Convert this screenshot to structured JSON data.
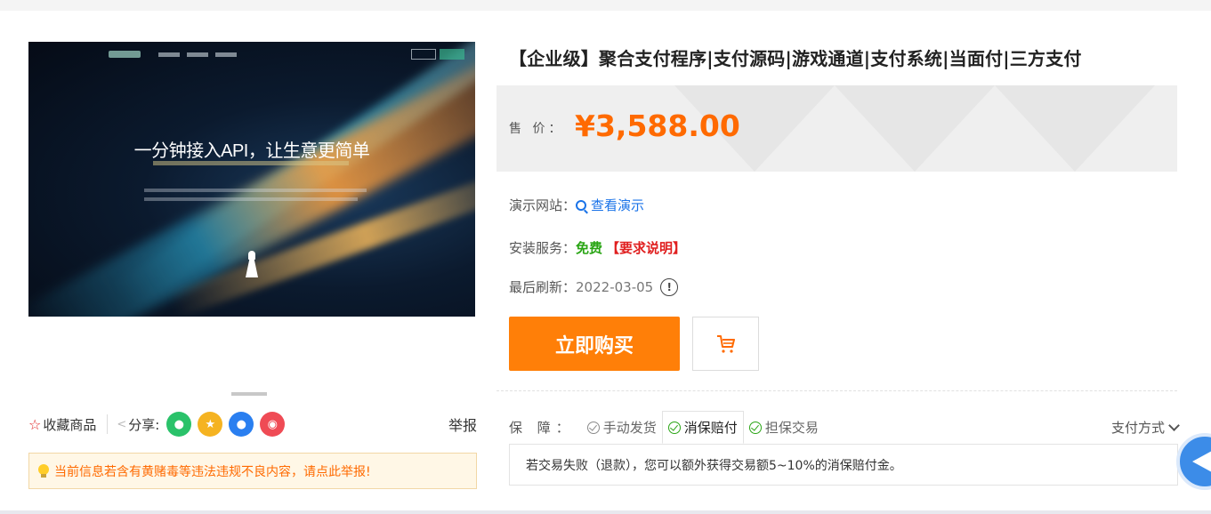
{
  "product": {
    "title": "【企业级】聚合支付程序|支付源码|游戏通道|支付系统|当面付|三方支付",
    "image": {
      "headline": "一分钟接入API，让生意更简单"
    }
  },
  "price": {
    "label": "售  价：",
    "value": "¥3,588.00"
  },
  "details": {
    "demo_label": "演示网站：",
    "demo_link": "查看演示",
    "install_label": "安装服务：",
    "install_value": "免费",
    "install_req": "【要求说明】",
    "refresh_label": "最后刷新：",
    "refresh_date": "2022-03-05",
    "info_icon_glyph": "!"
  },
  "actions": {
    "buy_label": "立即购买",
    "cart_icon": "cart-icon"
  },
  "guarantee": {
    "label": "保  障：",
    "tabs": [
      {
        "label": "手动发货",
        "state": "normal"
      },
      {
        "label": "消保赔付",
        "state": "active"
      },
      {
        "label": "担保交易",
        "state": "green"
      }
    ],
    "pay_method": "支付方式",
    "description": "若交易失败（退款），您可以额外获得交易额5~10%的消保赔付金。"
  },
  "share": {
    "favorite": "收藏商品",
    "share_label": "分享:",
    "report": "举报",
    "icons": [
      "wechat-icon",
      "qzone-icon",
      "qq-icon",
      "weibo-icon"
    ]
  },
  "warning": {
    "text": "当前信息若含有黄赌毒等违法违规不良内容，请点此举报!"
  },
  "colors": {
    "accent_orange": "#ff6a00",
    "buy_button": "#ff7f08",
    "link_blue": "#1a73e8",
    "free_green": "#2aa515",
    "alert_red": "#e02020"
  }
}
